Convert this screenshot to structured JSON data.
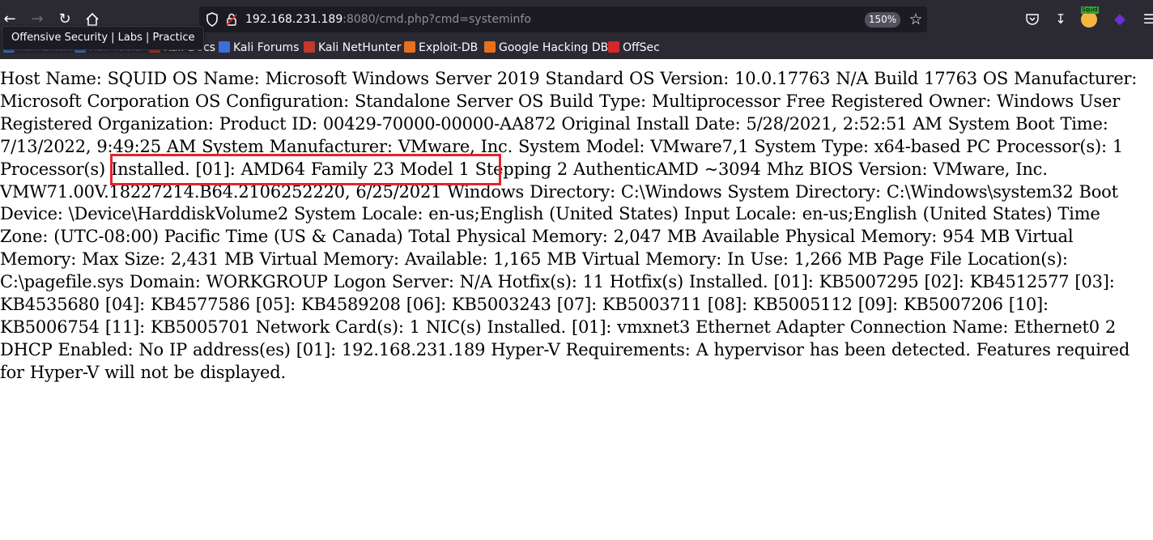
{
  "tooltip": "Offensive Security | Labs | Practice",
  "url": {
    "host": "192.168.231.189",
    "rest": ":8080/cmd.php?cmd=systeminfo"
  },
  "zoom": "150%",
  "bookmarks": [
    {
      "label": "Kali Linux",
      "color": "#4a7bd0",
      "ghost": true
    },
    {
      "label": "Kali Tools",
      "color": "#4a7bd0",
      "ghost": true
    },
    {
      "label": "Kali Docs",
      "color": "#c0392b",
      "ghost": true
    },
    {
      "label": "Kali Forums",
      "color": "#3c6fd8",
      "ghost": false
    },
    {
      "label": "Kali NetHunter",
      "color": "#c0392b",
      "ghost": false
    },
    {
      "label": "Exploit-DB",
      "color": "#e8701a",
      "ghost": false
    },
    {
      "label": "Google Hacking DB",
      "color": "#e8701a",
      "ghost": false
    },
    {
      "label": "OffSec",
      "color": "#d62828",
      "ghost": false
    }
  ],
  "icons": {
    "extension_badge": "Squid"
  },
  "output": "Host Name: SQUID OS Name: Microsoft Windows Server 2019 Standard OS Version: 10.0.17763 N/A Build 17763 OS Manufacturer: Microsoft Corporation OS Configuration: Standalone Server OS Build Type: Multiprocessor Free Registered Owner: Windows User Registered Organization: Product ID: 00429-70000-00000-AA872 Original Install Date: 5/28/2021, 2:52:51 AM System Boot Time: 7/13/2022, 9:49:25 AM System Manufacturer: VMware, Inc. System Model: VMware7,1 System Type: x64-based PC Processor(s): 1 Processor(s) Installed. [01]: AMD64 Family 23 Model 1 Stepping 2 AuthenticAMD ~3094 Mhz BIOS Version: VMware, Inc. VMW71.00V.18227214.B64.2106252220, 6/25/2021 Windows Directory: C:\\Windows System Directory: C:\\Windows\\system32 Boot Device: \\Device\\HarddiskVolume2 System Locale: en-us;English (United States) Input Locale: en-us;English (United States) Time Zone: (UTC-08:00) Pacific Time (US & Canada) Total Physical Memory: 2,047 MB Available Physical Memory: 954 MB Virtual Memory: Max Size: 2,431 MB Virtual Memory: Available: 1,165 MB Virtual Memory: In Use: 1,266 MB Page File Location(s): C:\\pagefile.sys Domain: WORKGROUP Logon Server: N/A Hotfix(s): 11 Hotfix(s) Installed. [01]: KB5007295 [02]: KB4512577 [03]: KB4535680 [04]: KB4577586 [05]: KB4589208 [06]: KB5003243 [07]: KB5003711 [08]: KB5005112 [09]: KB5007206 [10]: KB5006754 [11]: KB5005701 Network Card(s): 1 NIC(s) Installed. [01]: vmxnet3 Ethernet Adapter Connection Name: Ethernet0 2 DHCP Enabled: No IP address(es) [01]: 192.168.231.189 Hyper-V Requirements: A hypervisor has been detected. Features required for Hyper-V will not be displayed.",
  "colors": {
    "chrome": "#2b2a33",
    "urlbar": "#1c1b22",
    "highlight": "#e4242c"
  }
}
